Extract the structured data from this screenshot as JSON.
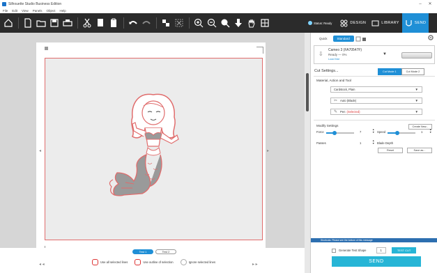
{
  "window": {
    "title": "Silhouette Studio Business Edition",
    "minimize": "–",
    "close": "✕"
  },
  "menu": [
    "File",
    "Edit",
    "View",
    "Panels",
    "Object",
    "Help"
  ],
  "toolbar_icons": [
    "home-icon",
    "new-page-icon",
    "open-icon",
    "save-icon",
    "print-icon",
    "cut-icon",
    "copy-icon",
    "paste-icon",
    "undo-icon",
    "redo-icon",
    "group-icon",
    "ungroup-icon",
    "zoom-in-icon",
    "zoom-out-icon",
    "zoom-fit-icon",
    "move-down-icon",
    "pan-icon",
    "add-page-icon"
  ],
  "topnav": {
    "status": "Status: Ready",
    "design": "DESIGN",
    "library": "LIBRARY",
    "send": "SEND"
  },
  "panel": {
    "tabs": {
      "quick": "Quick",
      "standard": "Standard"
    },
    "machine": {
      "name": "Cameo 3 (FA70547F)",
      "status": "Ready — 0%",
      "link": "Load Mat"
    },
    "cut_settings_title": "Cut Settings...",
    "cut_mode_1": "Cut Mode 1",
    "cut_mode_2": "Cut Mode 2",
    "material_title": "Material, Action and Tool",
    "material": "Cardstock, Plain",
    "action": "Auto (Blade)",
    "tool": "Pen",
    "tool_status": "(Selected)",
    "modify_title": "Modify Settings",
    "create_new": "Create New...",
    "force_label": "Force",
    "force_value": "7",
    "speed_label": "Speed",
    "speed_value": "1",
    "passes_label": "Passes",
    "passes_value": "1",
    "blade_depth_label": "Blade Depth",
    "reset_btn": "Reset",
    "save_btn": "Save as...",
    "notice": "Shortcuts: Please see the bottom of this message",
    "test_shape_label": "Generate Test Shape",
    "test_value": "1",
    "test_cut_btn": "TEST CUT",
    "send_btn": "SEND"
  },
  "canvas": {
    "toggle_on": "Test 1",
    "toggle_off": "Test 2",
    "line_btn_1": "Use all selected lines",
    "line_btn_2": "Use outline of selection",
    "line_btn_3": "Ignore selected lines"
  },
  "colors": {
    "accent": "#1f8fd6",
    "send": "#27b5d6",
    "cutline": "#e06c6c",
    "toolbar": "#2b2b2b"
  },
  "sliders": {
    "force": 0.3,
    "speed": 0.35
  }
}
